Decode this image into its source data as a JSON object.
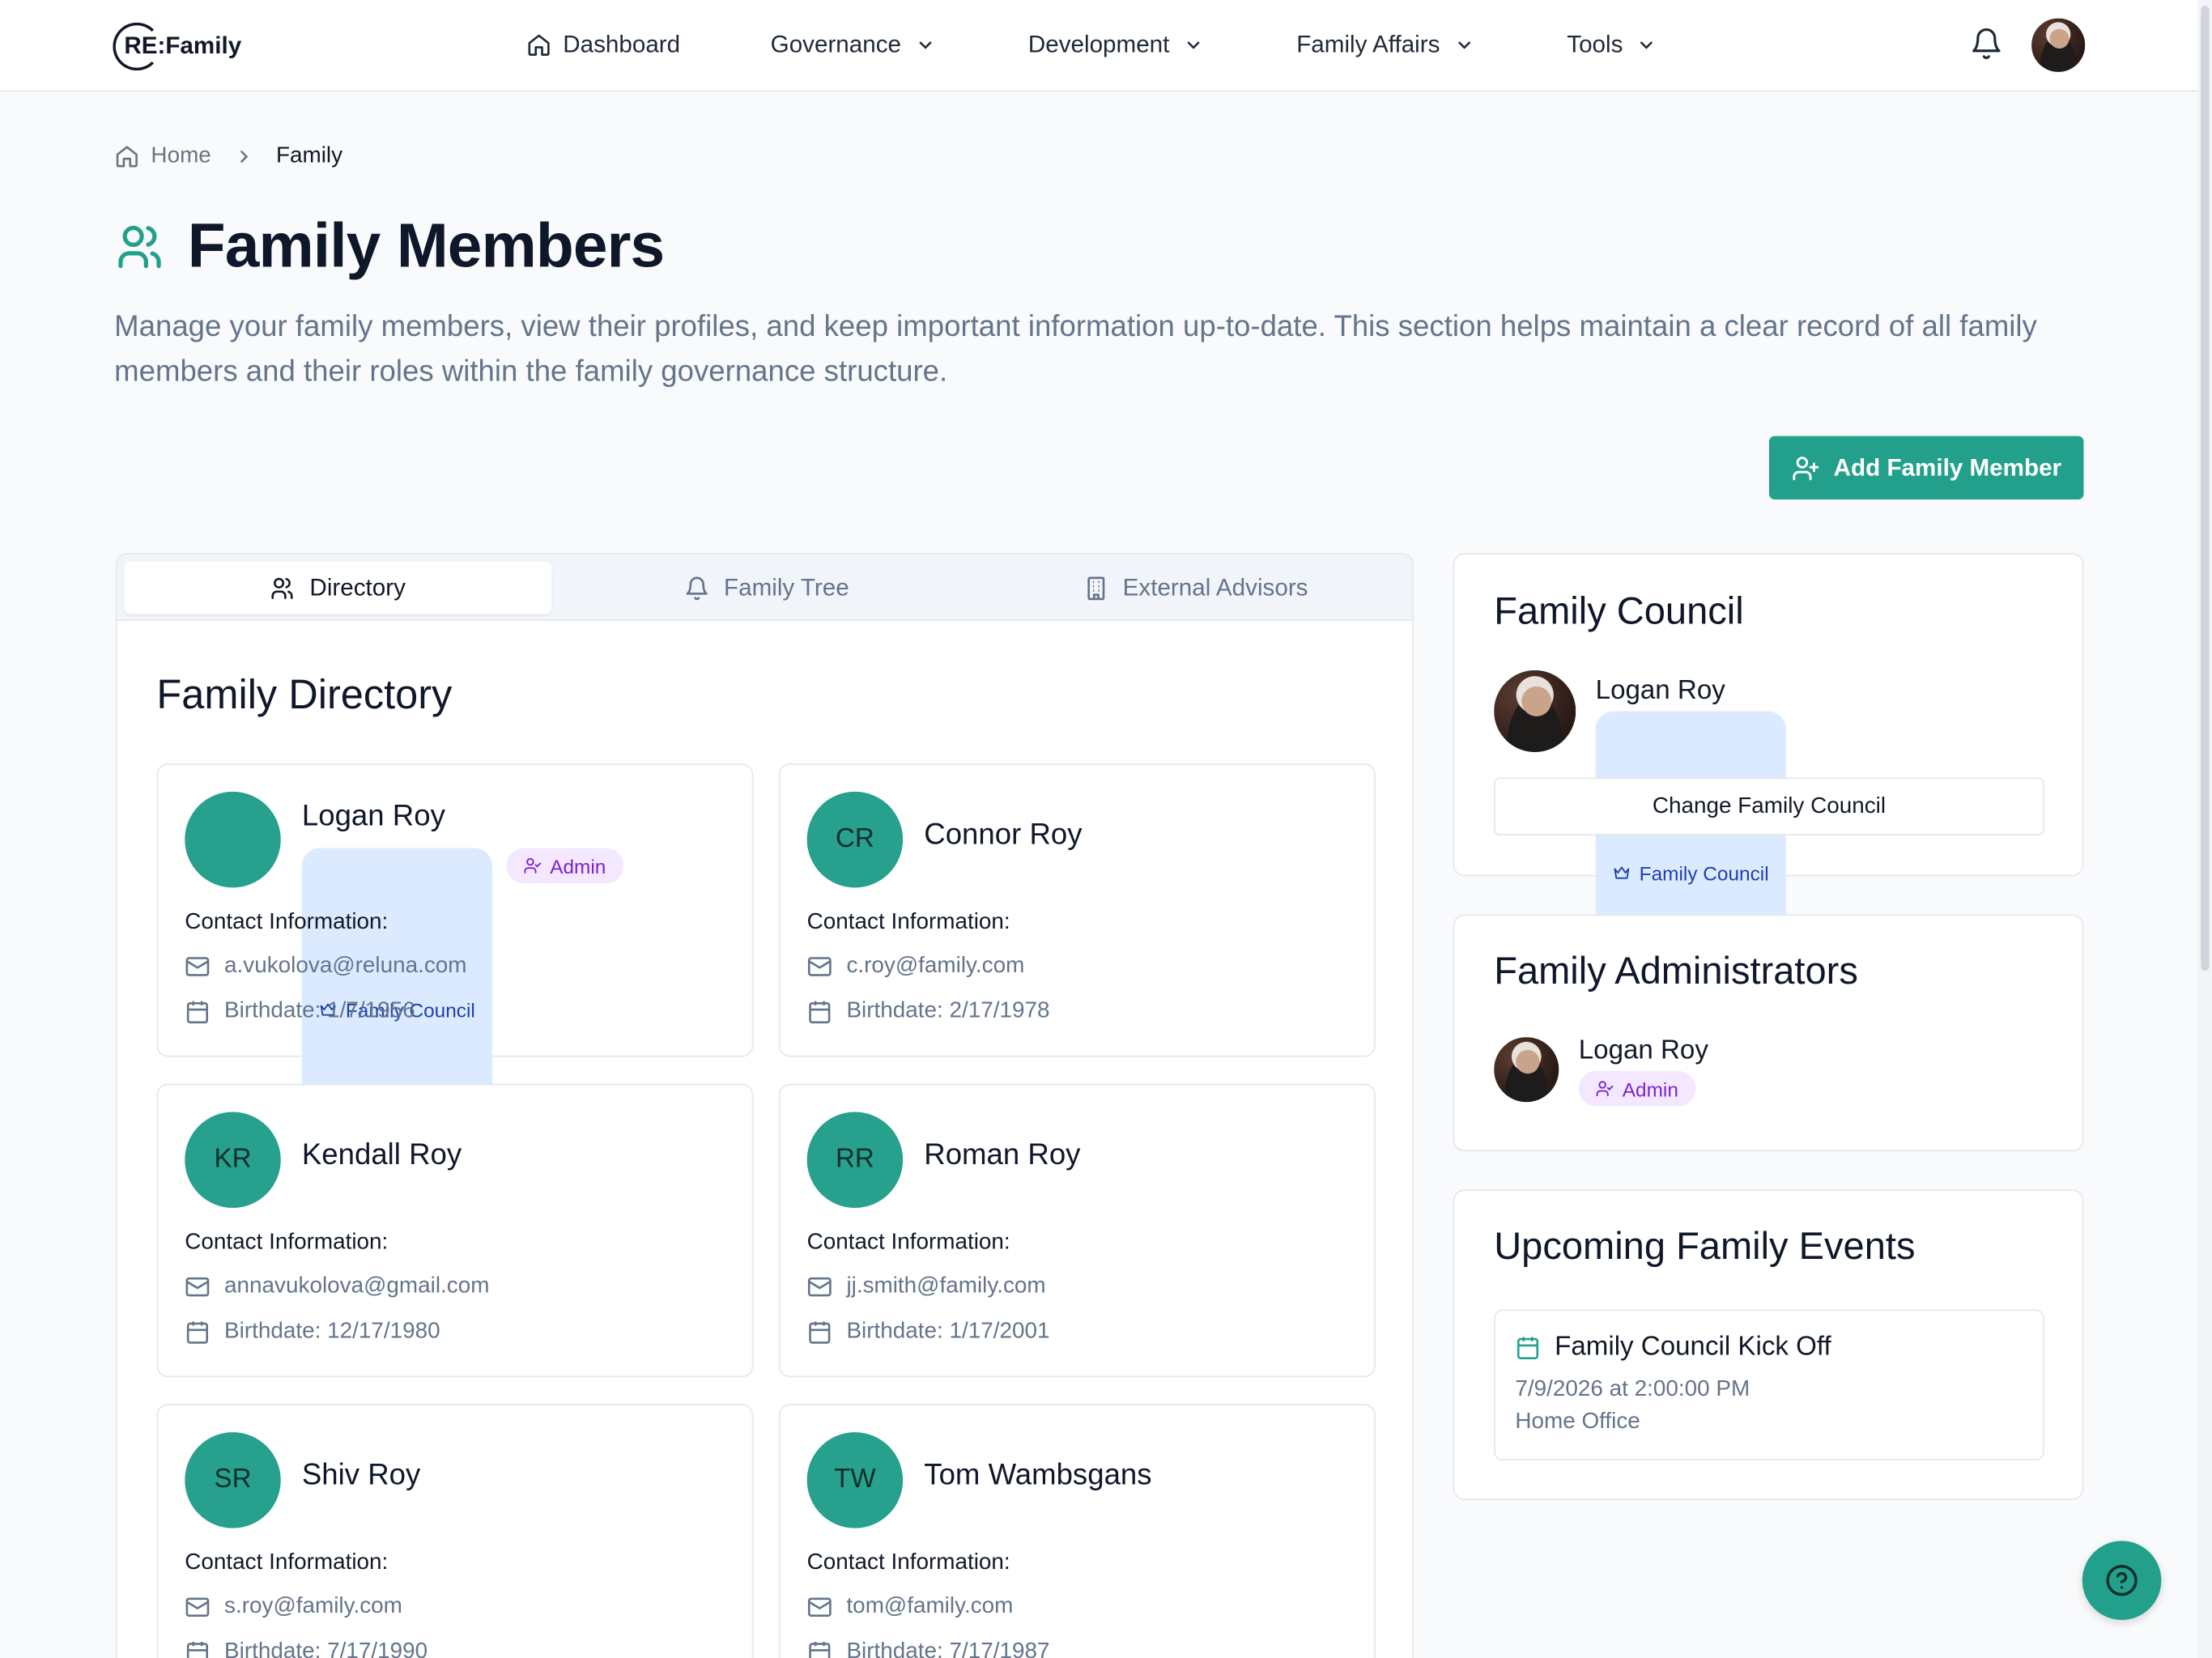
{
  "brand": {
    "logo_text": "RE:Family"
  },
  "nav": {
    "items": [
      {
        "label": "Dashboard",
        "icon": "home-icon"
      },
      {
        "label": "Governance",
        "icon": "chevron-down-icon"
      },
      {
        "label": "Development",
        "icon": "chevron-down-icon"
      },
      {
        "label": "Family Affairs",
        "icon": "chevron-down-icon"
      },
      {
        "label": "Tools",
        "icon": "chevron-down-icon"
      }
    ]
  },
  "breadcrumb": {
    "home": "Home",
    "current": "Family"
  },
  "page": {
    "title": "Family Members",
    "description": "Manage your family members, view their profiles, and keep important information up-to-date. This section helps maintain a clear record of all family members and their roles within the family governance structure.",
    "add_button": "Add Family Member"
  },
  "tabs": [
    {
      "label": "Directory",
      "active": true
    },
    {
      "label": "Family Tree",
      "active": false
    },
    {
      "label": "External Advisors",
      "active": false
    }
  ],
  "directory": {
    "title": "Family Directory",
    "contact_label": "Contact Information:",
    "members": [
      {
        "name": "Logan Roy",
        "initials": "",
        "photo": true,
        "badges": [
          "Family Council",
          "Admin"
        ],
        "email": "a.vukolova@reluna.com",
        "birthdate": "Birthdate: 1/7/1956"
      },
      {
        "name": "Connor Roy",
        "initials": "CR",
        "photo": false,
        "badges": [],
        "email": "c.roy@family.com",
        "birthdate": "Birthdate: 2/17/1978"
      },
      {
        "name": "Kendall Roy",
        "initials": "KR",
        "photo": false,
        "badges": [],
        "email": "annavukolova@gmail.com",
        "birthdate": "Birthdate: 12/17/1980"
      },
      {
        "name": "Roman Roy",
        "initials": "RR",
        "photo": false,
        "badges": [],
        "email": "jj.smith@family.com",
        "birthdate": "Birthdate: 1/17/2001"
      },
      {
        "name": "Shiv Roy",
        "initials": "SR",
        "photo": false,
        "badges": [],
        "email": "s.roy@family.com",
        "birthdate": "Birthdate: 7/17/1990"
      },
      {
        "name": "Tom Wambsgans",
        "initials": "TW",
        "photo": false,
        "badges": [],
        "email": "tom@family.com",
        "birthdate": "Birthdate: 7/17/1987"
      }
    ]
  },
  "council": {
    "title": "Family Council",
    "member_name": "Logan Roy",
    "badge": "Family Council",
    "button": "Change Family Council"
  },
  "admins": {
    "title": "Family Administrators",
    "member_name": "Logan Roy",
    "badge": "Admin"
  },
  "events": {
    "title": "Upcoming Family Events",
    "items": [
      {
        "title": "Family Council Kick Off",
        "datetime": "7/9/2026 at 2:00:00 PM",
        "location": "Home Office"
      }
    ]
  },
  "colors": {
    "accent": "#23a08b",
    "council_badge_bg": "#dbeafe",
    "admin_badge_bg": "#f3e8ff"
  }
}
